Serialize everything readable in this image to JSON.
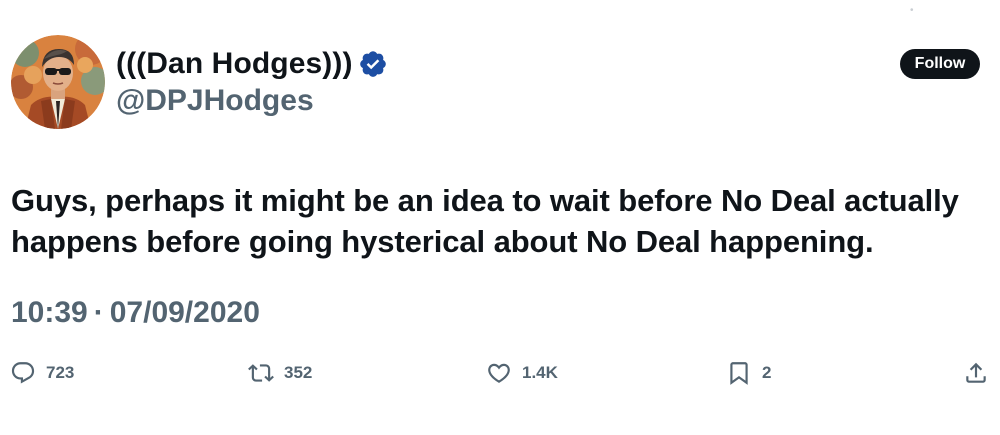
{
  "author": {
    "display_name": "(((Dan Hodges)))",
    "handle": "@DPJHodges",
    "verified": true,
    "verified_color": "#1d4ea3"
  },
  "follow_button": {
    "label": "Follow"
  },
  "tweet": {
    "text": "Guys, perhaps it might be an idea to wait before No Deal actually happens before going hysterical about No Deal happening.",
    "time": "10:39",
    "separator": "·",
    "date": "07/09/2020"
  },
  "actions": {
    "replies": "723",
    "retweets": "352",
    "likes": "1.4K",
    "bookmarks": "2"
  },
  "icons": {
    "reply": "reply-icon",
    "retweet": "retweet-icon",
    "like": "heart-icon",
    "bookmark": "bookmark-icon",
    "share": "share-icon",
    "verified": "verified-badge-icon"
  },
  "colors": {
    "text_primary": "#0f1419",
    "text_secondary": "#536471",
    "button_bg": "#0f1419"
  }
}
